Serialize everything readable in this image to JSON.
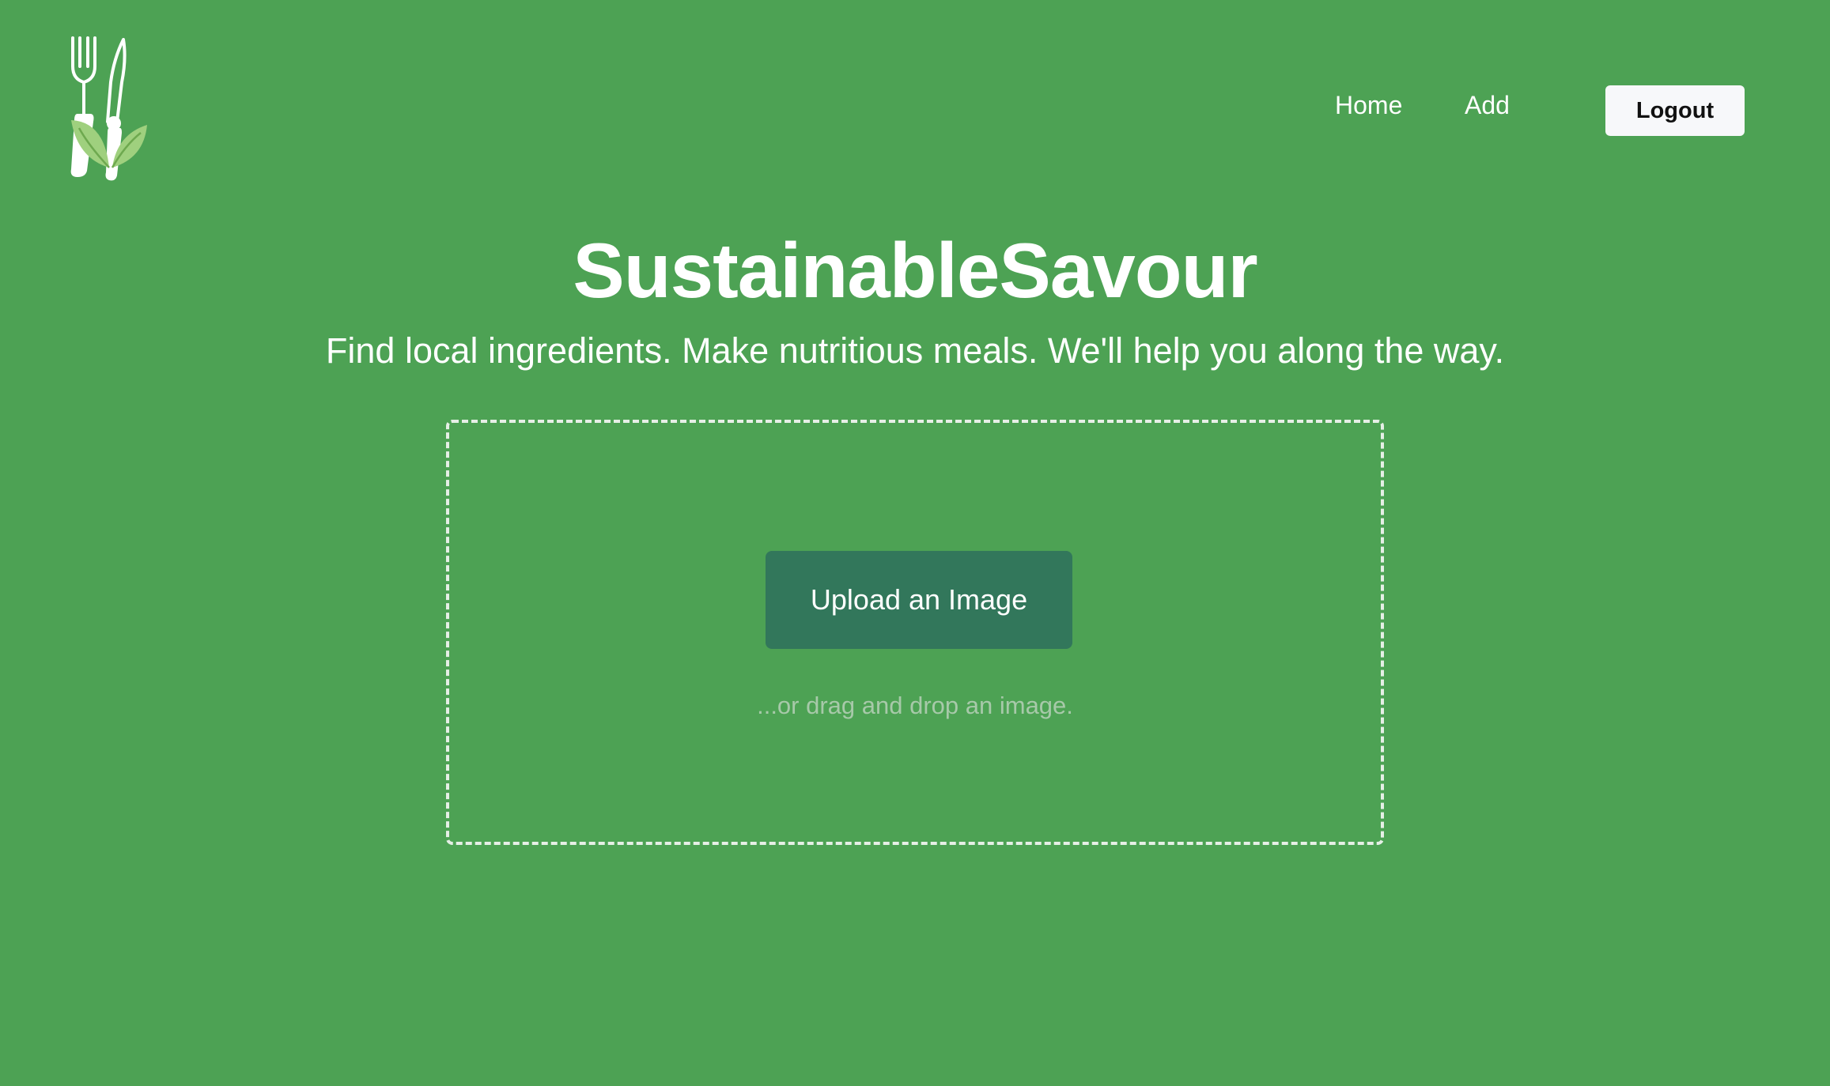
{
  "header": {
    "logo_icon": "fork-knife-leaf-icon",
    "nav": {
      "home_label": "Home",
      "add_label": "Add"
    },
    "logout_label": "Logout"
  },
  "hero": {
    "title": "SustainableSavour",
    "subtitle": "Find local ingredients. Make nutritious meals. We'll help you along the way."
  },
  "upload": {
    "button_label": "Upload an Image",
    "hint": "...or drag and drop an image."
  },
  "colors": {
    "background": "#4da254",
    "upload_button": "#32775b",
    "leaf": "#9fd07e",
    "logout_bg": "#f7f8fa"
  }
}
